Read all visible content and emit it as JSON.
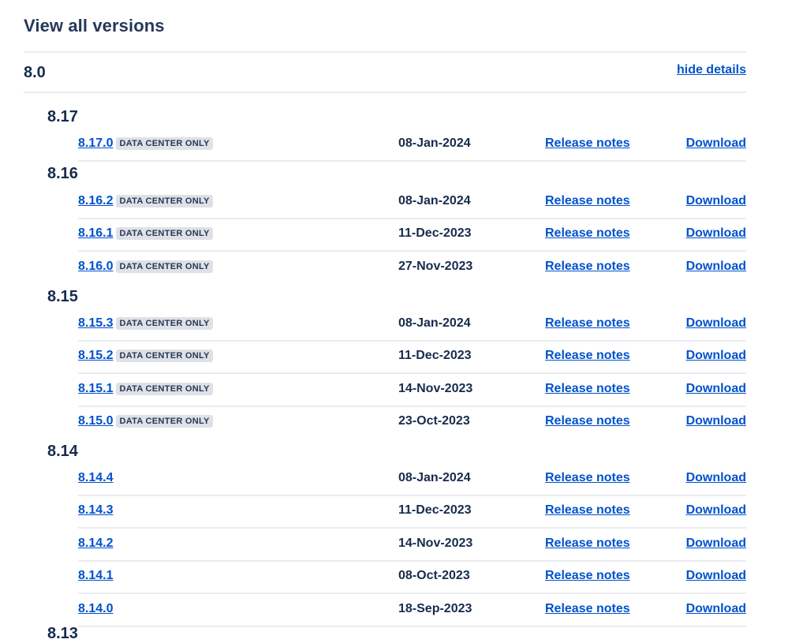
{
  "page": {
    "title": "View all versions",
    "major_version": "8.0",
    "hide_details_label": "hide details"
  },
  "groups": [
    {
      "label": "8.17",
      "versions": [
        {
          "version": "8.17.0",
          "badge": "DATA CENTER ONLY",
          "date": "08-Jan-2024",
          "notes_label": "Release notes",
          "download_label": "Download"
        }
      ]
    },
    {
      "label": "8.16",
      "versions": [
        {
          "version": "8.16.2",
          "badge": "DATA CENTER ONLY",
          "date": "08-Jan-2024",
          "notes_label": "Release notes",
          "download_label": "Download"
        },
        {
          "version": "8.16.1",
          "badge": "DATA CENTER ONLY",
          "date": "11-Dec-2023",
          "notes_label": "Release notes",
          "download_label": "Download"
        },
        {
          "version": "8.16.0",
          "badge": "DATA CENTER ONLY",
          "date": "27-Nov-2023",
          "notes_label": "Release notes",
          "download_label": "Download"
        }
      ]
    },
    {
      "label": "8.15",
      "versions": [
        {
          "version": "8.15.3",
          "badge": "DATA CENTER ONLY",
          "date": "08-Jan-2024",
          "notes_label": "Release notes",
          "download_label": "Download"
        },
        {
          "version": "8.15.2",
          "badge": "DATA CENTER ONLY",
          "date": "11-Dec-2023",
          "notes_label": "Release notes",
          "download_label": "Download"
        },
        {
          "version": "8.15.1",
          "badge": "DATA CENTER ONLY",
          "date": "14-Nov-2023",
          "notes_label": "Release notes",
          "download_label": "Download"
        },
        {
          "version": "8.15.0",
          "badge": "DATA CENTER ONLY",
          "date": "23-Oct-2023",
          "notes_label": "Release notes",
          "download_label": "Download"
        }
      ]
    },
    {
      "label": "8.14",
      "versions": [
        {
          "version": "8.14.4",
          "badge": "",
          "date": "08-Jan-2024",
          "notes_label": "Release notes",
          "download_label": "Download"
        },
        {
          "version": "8.14.3",
          "badge": "",
          "date": "11-Dec-2023",
          "notes_label": "Release notes",
          "download_label": "Download"
        },
        {
          "version": "8.14.2",
          "badge": "",
          "date": "14-Nov-2023",
          "notes_label": "Release notes",
          "download_label": "Download"
        },
        {
          "version": "8.14.1",
          "badge": "",
          "date": "08-Oct-2023",
          "notes_label": "Release notes",
          "download_label": "Download"
        },
        {
          "version": "8.14.0",
          "badge": "",
          "date": "18-Sep-2023",
          "notes_label": "Release notes",
          "download_label": "Download"
        }
      ]
    },
    {
      "label": "8.13",
      "versions": []
    }
  ],
  "colors": {
    "link": "#0052cc",
    "text": "#172b4d",
    "badge_bg": "#dfe1e6",
    "divider": "#ebecf0"
  }
}
